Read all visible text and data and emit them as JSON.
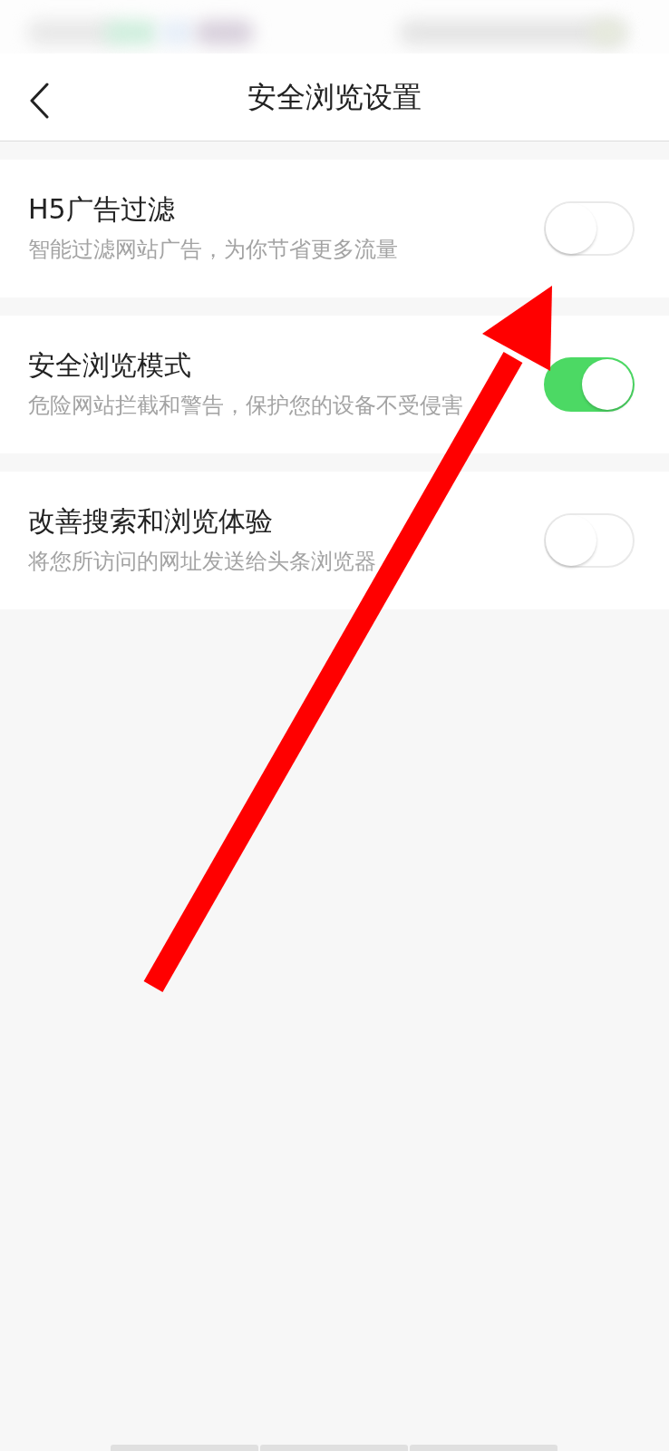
{
  "header": {
    "title": "安全浏览设置"
  },
  "settings": [
    {
      "title": "H5广告过滤",
      "description": "智能过滤网站广告，为你节省更多流量",
      "on": false
    },
    {
      "title": "安全浏览模式",
      "description": "危险网站拦截和警告，保护您的设备不受侵害",
      "on": true
    },
    {
      "title": "改善搜索和浏览体验",
      "description": "将您所访问的网址发送给头条浏览器",
      "on": false
    }
  ]
}
